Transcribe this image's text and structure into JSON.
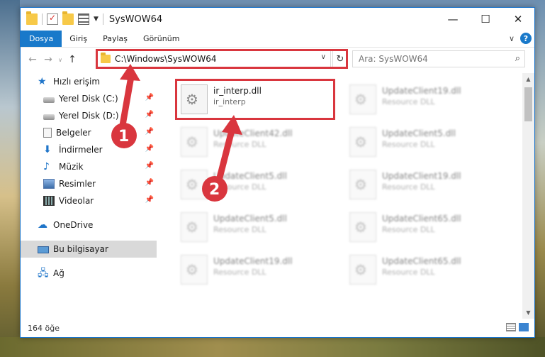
{
  "window": {
    "title": "SysWOW64",
    "minimize_glyph": "—",
    "maximize_glyph": "☐",
    "close_glyph": "✕"
  },
  "ribbon": {
    "tabs": [
      "Dosya",
      "Giriş",
      "Paylaş",
      "Görünüm"
    ],
    "expand_glyph": "∨",
    "help_glyph": "?"
  },
  "nav": {
    "back_glyph": "←",
    "forward_glyph": "→",
    "recent_glyph": "∨",
    "up_glyph": "↑",
    "address": "C:\\Windows\\SysWOW64",
    "refresh_glyph": "↻",
    "search_placeholder": "Ara: SysWOW64",
    "search_icon": "search-icon"
  },
  "sidebar": {
    "quick_access": "Hızlı erişim",
    "items": [
      {
        "label": "Yerel Disk (C:)",
        "icon": "disk-icon",
        "pinned": true
      },
      {
        "label": "Yerel Disk (D:)",
        "icon": "disk-icon",
        "pinned": true
      },
      {
        "label": "Belgeler",
        "icon": "documents-icon",
        "pinned": true
      },
      {
        "label": "İndirmeler",
        "icon": "downloads-icon",
        "pinned": true
      },
      {
        "label": "Müzik",
        "icon": "music-icon",
        "pinned": true
      },
      {
        "label": "Resimler",
        "icon": "pictures-icon",
        "pinned": true
      },
      {
        "label": "Videolar",
        "icon": "videos-icon",
        "pinned": true
      }
    ],
    "onedrive": "OneDrive",
    "this_pc": "Bu bilgisayar",
    "network": "Ağ"
  },
  "files": {
    "highlighted": {
      "name": "ir_interp.dll",
      "type": "ir_interp"
    },
    "blurred": [
      {
        "name": "UpdateClient19.dll",
        "type": "Resource DLL"
      },
      {
        "name": "UpdateClient42.dll",
        "type": "Resource DLL"
      },
      {
        "name": "UpdateClient5.dll",
        "type": "Resource DLL"
      },
      {
        "name": "UpdateClient5.dll",
        "type": "Resource DLL"
      },
      {
        "name": "UpdateClient19.dll",
        "type": "Resource DLL"
      },
      {
        "name": "UpdateClient5.dll",
        "type": "Resource DLL"
      },
      {
        "name": "UpdateClient65.dll",
        "type": "Resource DLL"
      },
      {
        "name": "UpdateClient19.dll",
        "type": "Resource DLL"
      },
      {
        "name": "UpdateClient65.dll",
        "type": "Resource DLL"
      }
    ]
  },
  "status": {
    "item_count": "164 öğe"
  },
  "annotations": {
    "step1": "1",
    "step2": "2",
    "color": "#d9363e"
  }
}
